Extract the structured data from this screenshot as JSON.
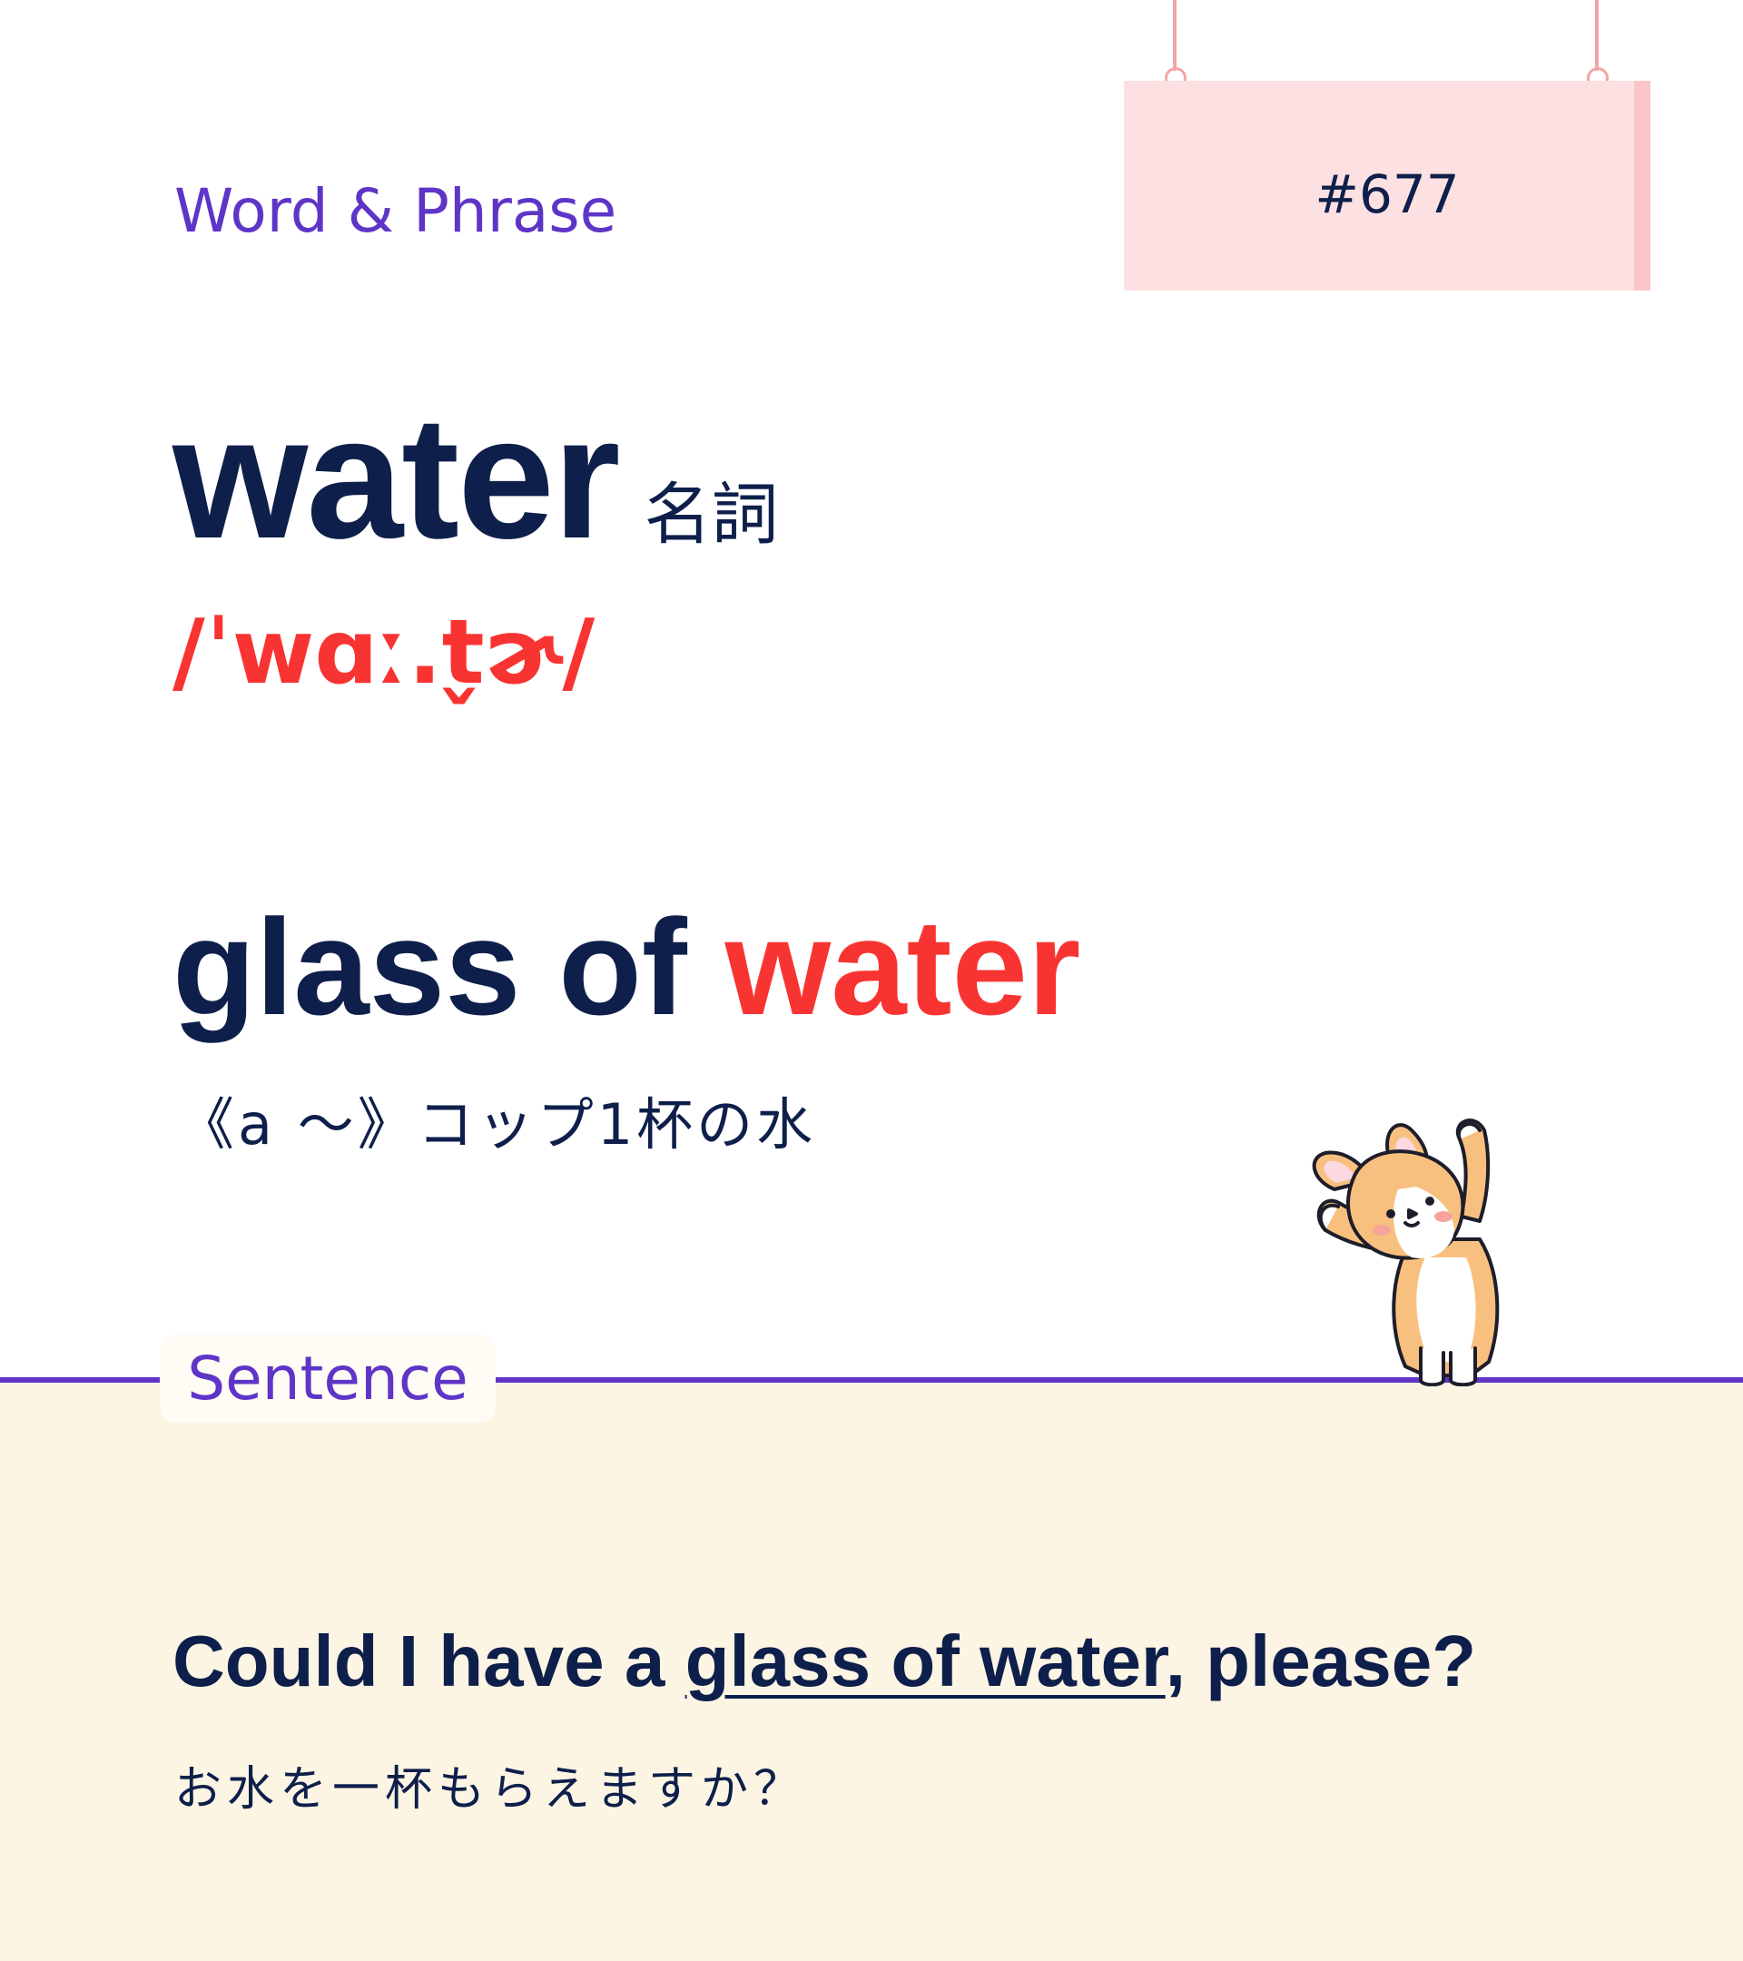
{
  "header": {
    "section_label": "Word & Phrase",
    "card_number": "#677"
  },
  "entry": {
    "headword": "water",
    "part_of_speech": "名詞",
    "pronunciation": "/ˈwɑː.t̬ɚ/"
  },
  "phrase": {
    "prefix": "glass of ",
    "highlight": "water",
    "meaning": "《a 〜》コップ1杯の水"
  },
  "sentence_section": {
    "label": "Sentence",
    "example_before": "Could I have a ",
    "example_underlined": "glass of water",
    "example_after": ", please?",
    "translation": "お水を一杯もらえますか？"
  },
  "colors": {
    "navy": "#0e1f4b",
    "accent_purple": "#5e35c7",
    "accent_red": "#f83432",
    "sign_pink": "#fde0e2",
    "bottom_cream": "#fdf5e4"
  },
  "icons": {
    "mascot": "corgi-mascot-icon"
  }
}
